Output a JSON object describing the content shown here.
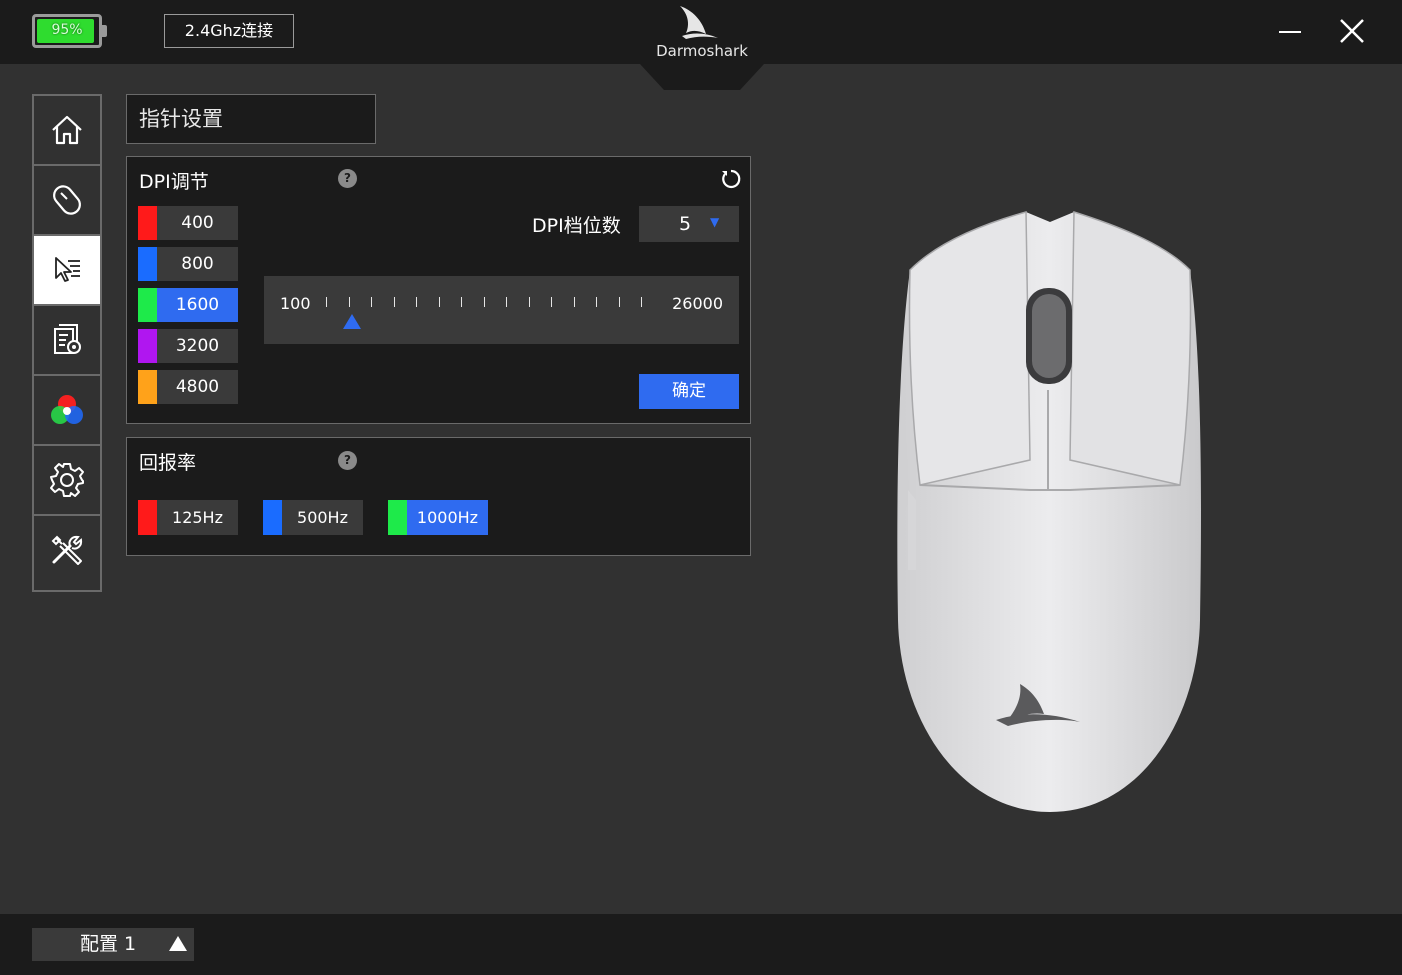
{
  "header": {
    "battery_text": "95%",
    "battery_level": 0.95,
    "battery_color": "#2fdc2f",
    "connection_label": "2.4Ghz连接",
    "brand": "Darmoshark"
  },
  "sidebar": {
    "items": [
      {
        "icon": "home-icon"
      },
      {
        "icon": "mouse-icon"
      },
      {
        "icon": "pointer-settings-icon",
        "active": true
      },
      {
        "icon": "macro-settings-icon"
      },
      {
        "icon": "rgb-lighting-icon"
      },
      {
        "icon": "gear-icon"
      },
      {
        "icon": "tools-icon"
      }
    ]
  },
  "page": {
    "title": "指针设置"
  },
  "dpi": {
    "label": "DPI调节",
    "help": "?",
    "levels_label": "DPI档位数",
    "levels_value": "5",
    "levels": [
      {
        "value": "400",
        "color": "#ff1a1a"
      },
      {
        "value": "800",
        "color": "#1a6cff"
      },
      {
        "value": "1600",
        "color": "#1eea4a",
        "selected": true
      },
      {
        "value": "3200",
        "color": "#b016f0"
      },
      {
        "value": "4800",
        "color": "#ffa21a"
      }
    ],
    "slider": {
      "min": "100",
      "max": "26000",
      "current_value": 1600,
      "ticks": 15
    },
    "confirm_label": "确定"
  },
  "polling_rate": {
    "label": "回报率",
    "help": "?",
    "options": [
      {
        "value": "125Hz",
        "color": "#ff1a1a"
      },
      {
        "value": "500Hz",
        "color": "#1a6cff"
      },
      {
        "value": "1000Hz",
        "color": "#1eea4a",
        "selected": true
      }
    ]
  },
  "footer": {
    "profile_label": "配置 1"
  },
  "colors": {
    "accent": "#2f6bf0",
    "panel_bg": "#1b1b1b",
    "app_bg": "#313131"
  }
}
